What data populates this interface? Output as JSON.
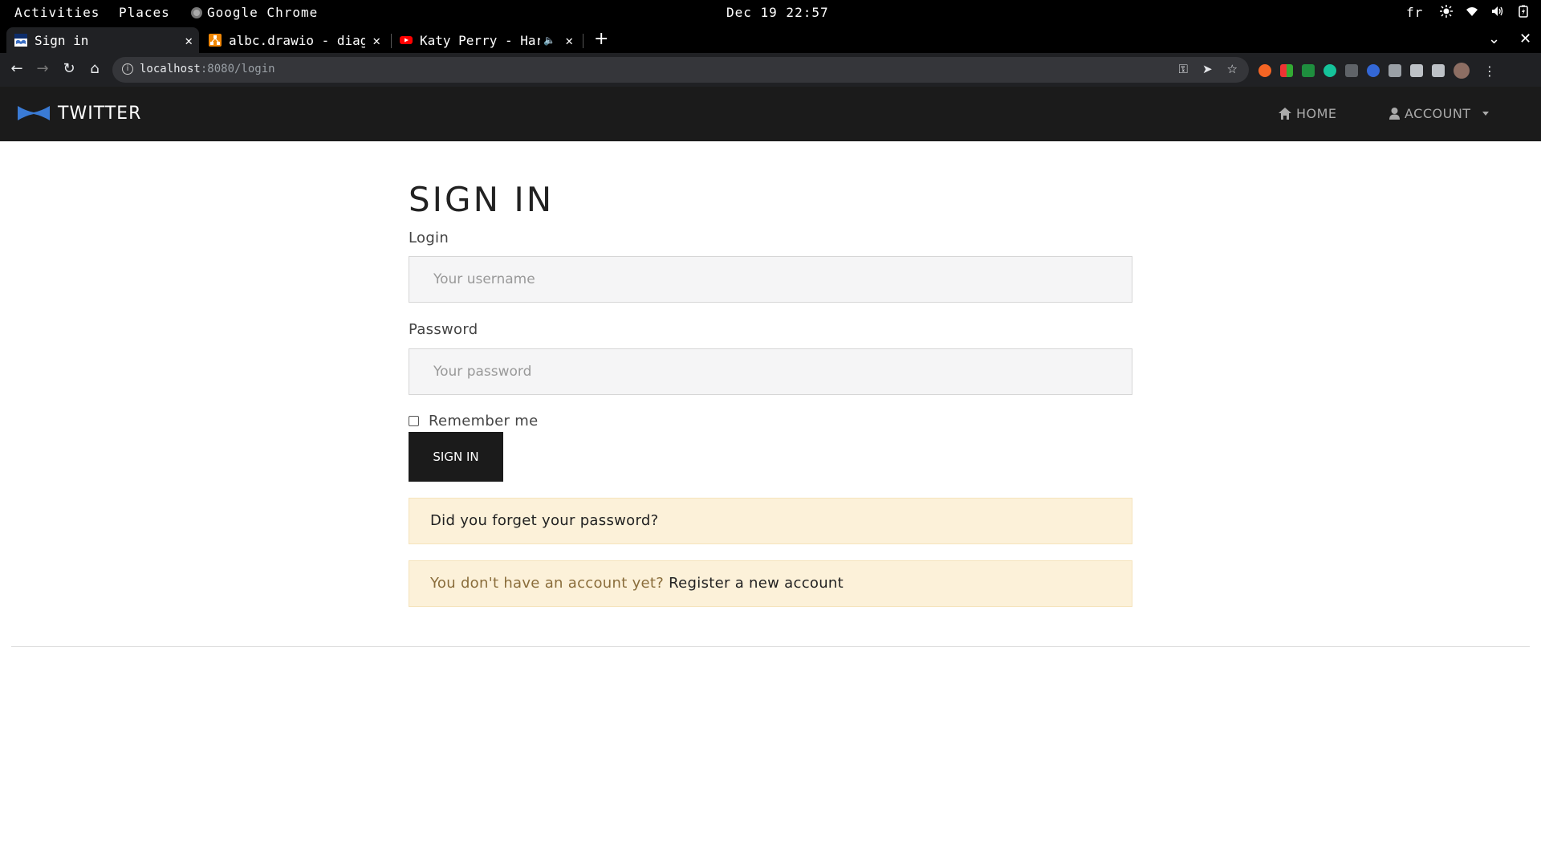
{
  "system_bar": {
    "activities": "Activities",
    "places": "Places",
    "app_name": "Google Chrome",
    "datetime": "Dec 19 22:57",
    "keyboard_layout": "fr",
    "tray_icons": [
      "brightness-icon",
      "wifi-icon",
      "volume-icon",
      "battery-icon"
    ]
  },
  "browser": {
    "tabs": [
      {
        "title": "Sign in",
        "active": true,
        "favicon": "twitter-app-favicon"
      },
      {
        "title": "albc.drawio - diagr",
        "active": false,
        "favicon": "drawio-favicon"
      },
      {
        "title": "Katy Perry - Har",
        "active": false,
        "favicon": "youtube-favicon",
        "audio": true
      }
    ],
    "new_tab_glyph": "+",
    "url_host": "localhost",
    "url_rest": ":8080/login"
  },
  "app": {
    "brand": "TWITTER",
    "nav": {
      "home": "HOME",
      "account": "ACCOUNT"
    }
  },
  "login_form": {
    "title": "SIGN IN",
    "login_label": "Login",
    "login_placeholder": "Your username",
    "login_value": "",
    "password_label": "Password",
    "password_placeholder": "Your password",
    "password_value": "",
    "remember_label": "Remember me",
    "remember_checked": false,
    "submit_label": "SIGN IN",
    "forgot_password": "Did you forget your password?",
    "no_account_text": "You don't have an account yet?",
    "register_link": "Register a new account"
  },
  "colors": {
    "navbar": "#1b1b1b",
    "alert_bg": "#fcf1d9",
    "button": "#1b1b1b"
  }
}
